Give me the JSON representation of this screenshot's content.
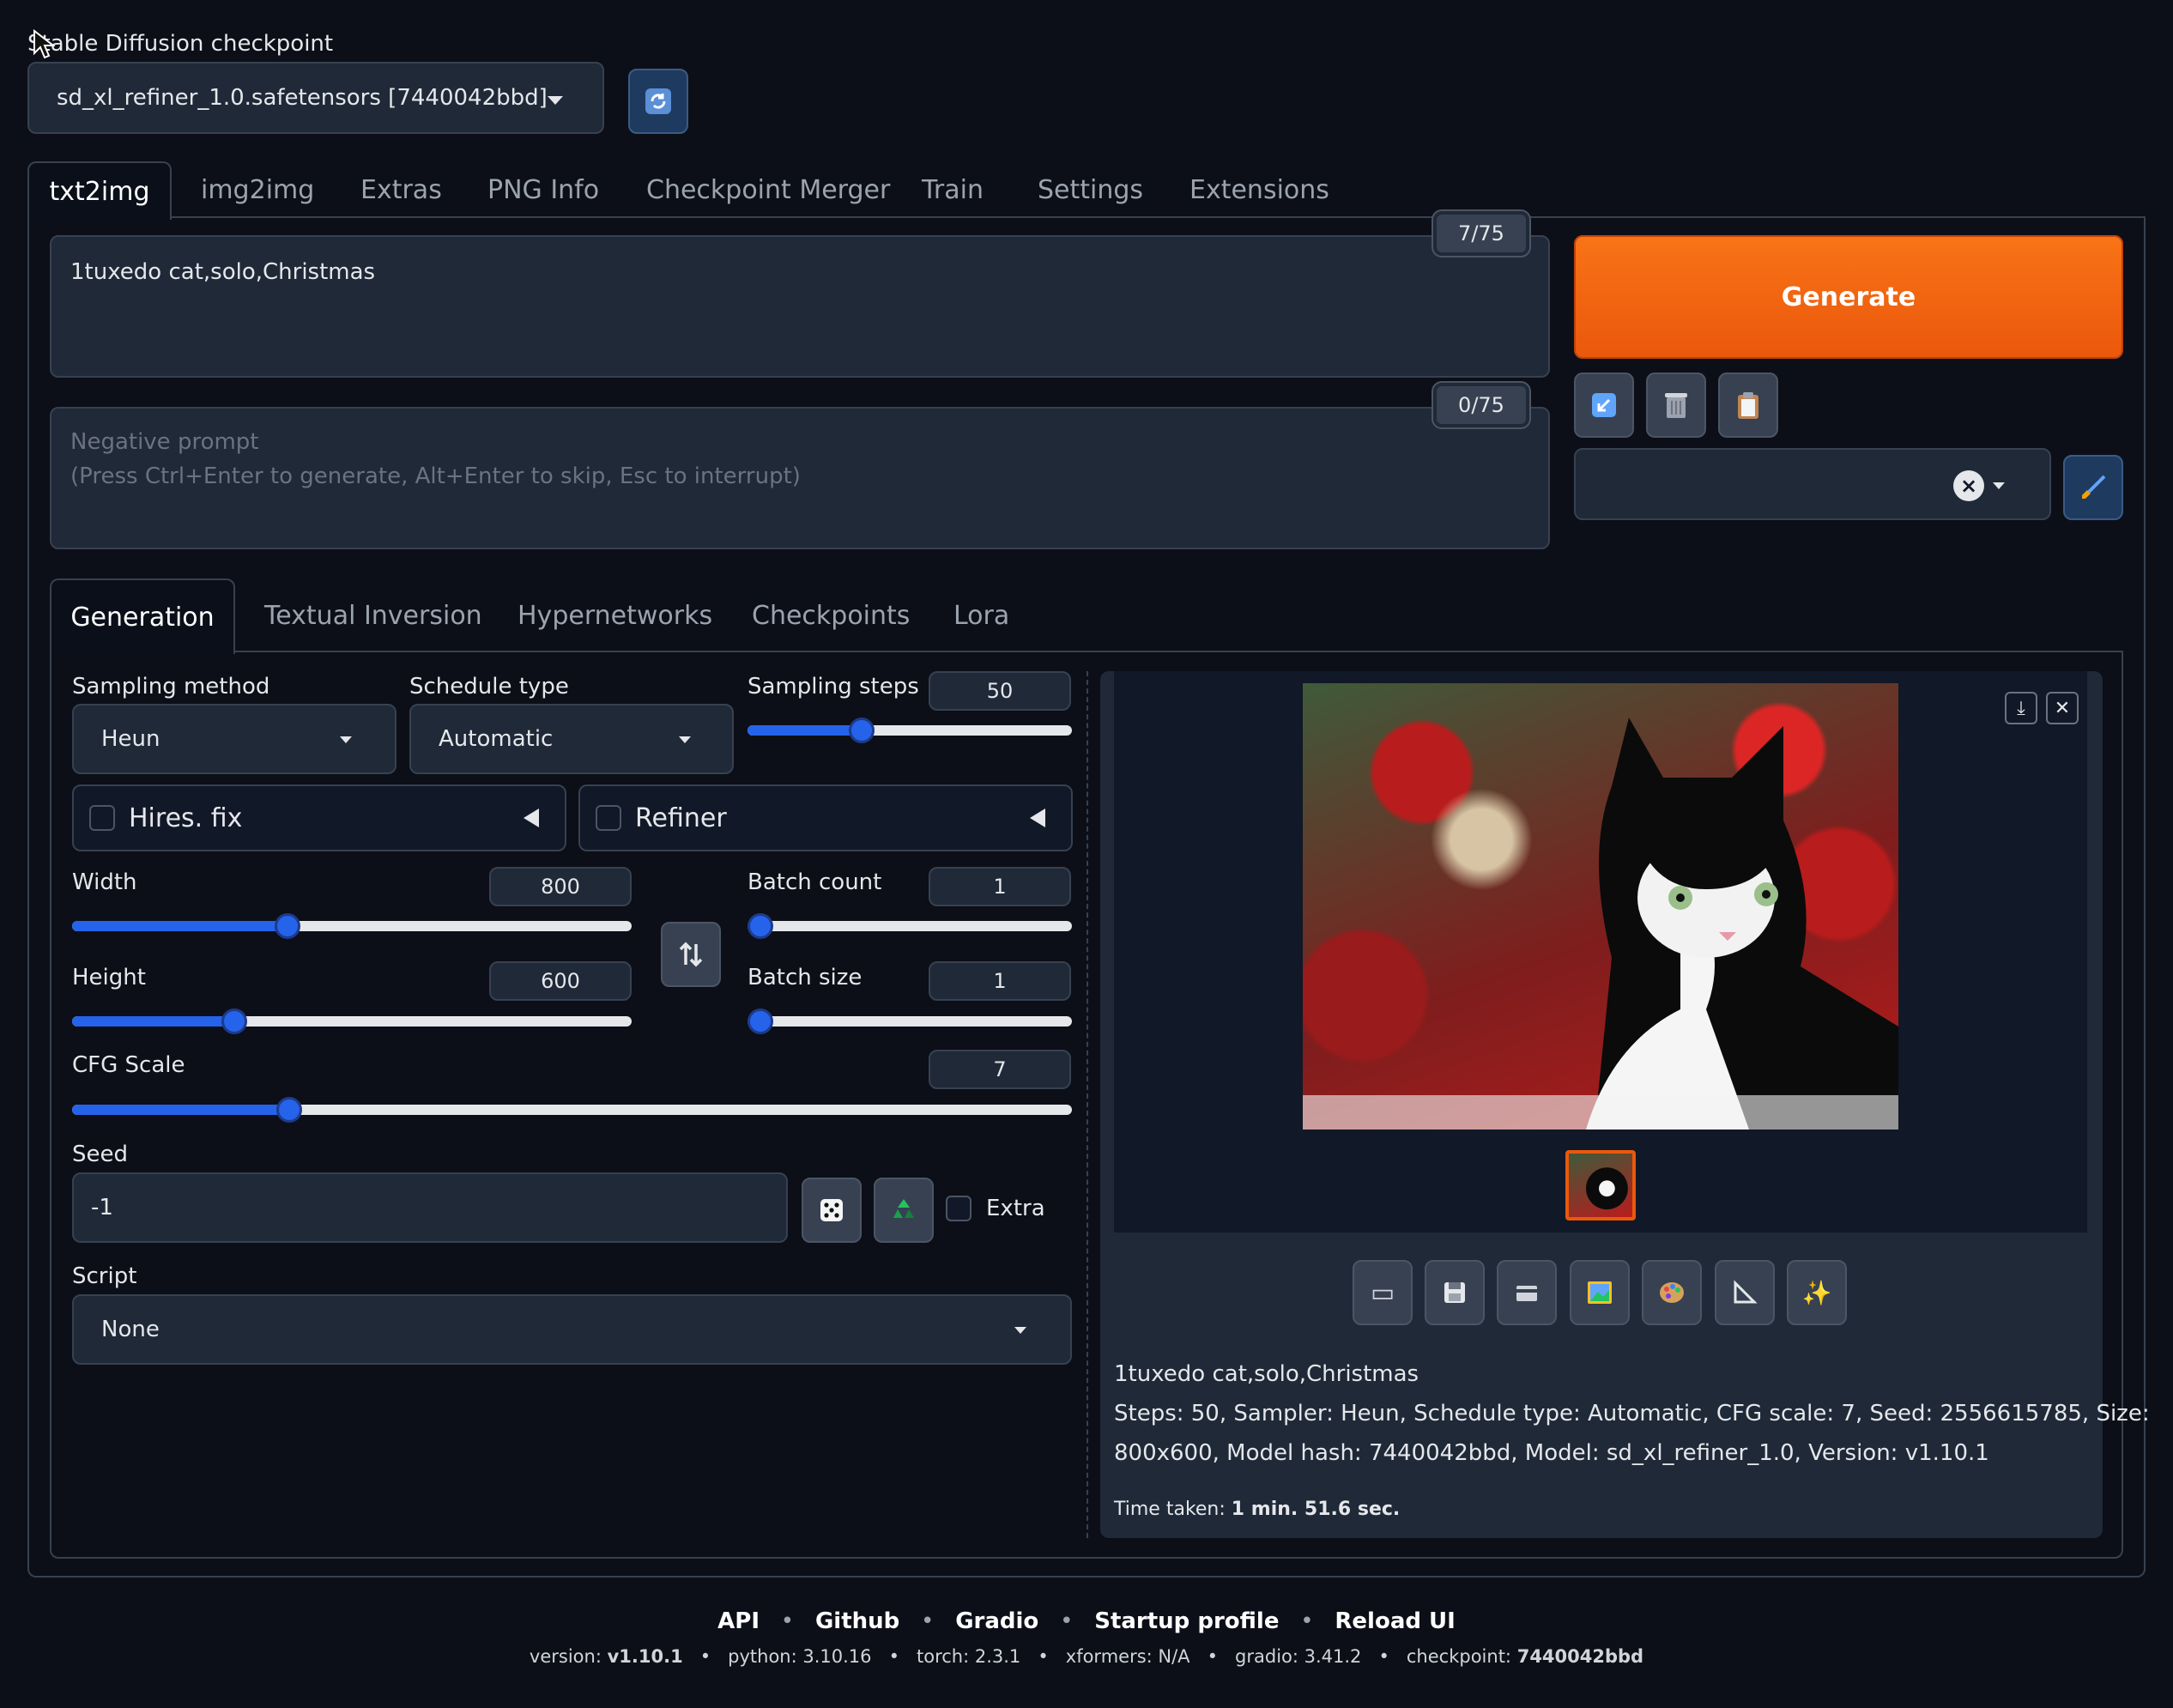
{
  "checkpoint": {
    "label": "Stable Diffusion checkpoint",
    "selected": "sd_xl_refiner_1.0.safetensors [7440042bbd]"
  },
  "main_tabs": [
    "txt2img",
    "img2img",
    "Extras",
    "PNG Info",
    "Checkpoint Merger",
    "Train",
    "Settings",
    "Extensions"
  ],
  "prompt": {
    "value": "1tuxedo cat,solo,Christmas",
    "token_count": "7/75"
  },
  "negative_prompt": {
    "placeholder_line1": "Negative prompt",
    "placeholder_line2": "(Press Ctrl+Enter to generate, Alt+Enter to skip, Esc to interrupt)",
    "token_count": "0/75"
  },
  "generate_label": "Generate",
  "sub_tabs": [
    "Generation",
    "Textual Inversion",
    "Hypernetworks",
    "Checkpoints",
    "Lora"
  ],
  "sampling_method": {
    "label": "Sampling method",
    "value": "Heun"
  },
  "schedule_type": {
    "label": "Schedule type",
    "value": "Automatic"
  },
  "sampling_steps": {
    "label": "Sampling steps",
    "value": "50",
    "fraction": 0.34
  },
  "hires_fix": {
    "label": "Hires. fix",
    "checked": false
  },
  "refiner": {
    "label": "Refiner",
    "checked": false
  },
  "width": {
    "label": "Width",
    "value": "800",
    "fraction": 0.38
  },
  "height": {
    "label": "Height",
    "value": "600",
    "fraction": 0.28
  },
  "batch_count": {
    "label": "Batch count",
    "value": "1",
    "fraction": 0.0
  },
  "batch_size": {
    "label": "Batch size",
    "value": "1",
    "fraction": 0.0
  },
  "cfg_scale": {
    "label": "CFG Scale",
    "value": "7",
    "fraction": 0.21
  },
  "seed": {
    "label": "Seed",
    "value": "-1",
    "extra_label": "Extra"
  },
  "script": {
    "label": "Script",
    "value": "None"
  },
  "output": {
    "prompt_text": "1tuxedo cat,solo,Christmas",
    "params_line1": "Steps: 50, Sampler: Heun, Schedule type: Automatic, CFG scale: 7, Seed: 2556615785, Size:",
    "params_line2": "800x600, Model hash: 7440042bbd, Model: sd_xl_refiner_1.0, Version: v1.10.1",
    "time_label": "Time taken:",
    "time_value": "1 min. 51.6 sec."
  },
  "footer": {
    "links": [
      "API",
      "Github",
      "Gradio",
      "Startup profile",
      "Reload UI"
    ],
    "version_label": "version:",
    "version": "v1.10.1",
    "python": "python: 3.10.16",
    "torch": "torch: 2.3.1",
    "xformers": "xformers: N/A",
    "gradio": "gradio: 3.41.2",
    "checkpoint_label": "checkpoint:",
    "checkpoint": "7440042bbd"
  },
  "colors": {
    "background": "#0c0f17",
    "panel": "#1f2937",
    "accent_orange": "#ea580c",
    "slider_blue": "#2563eb"
  }
}
